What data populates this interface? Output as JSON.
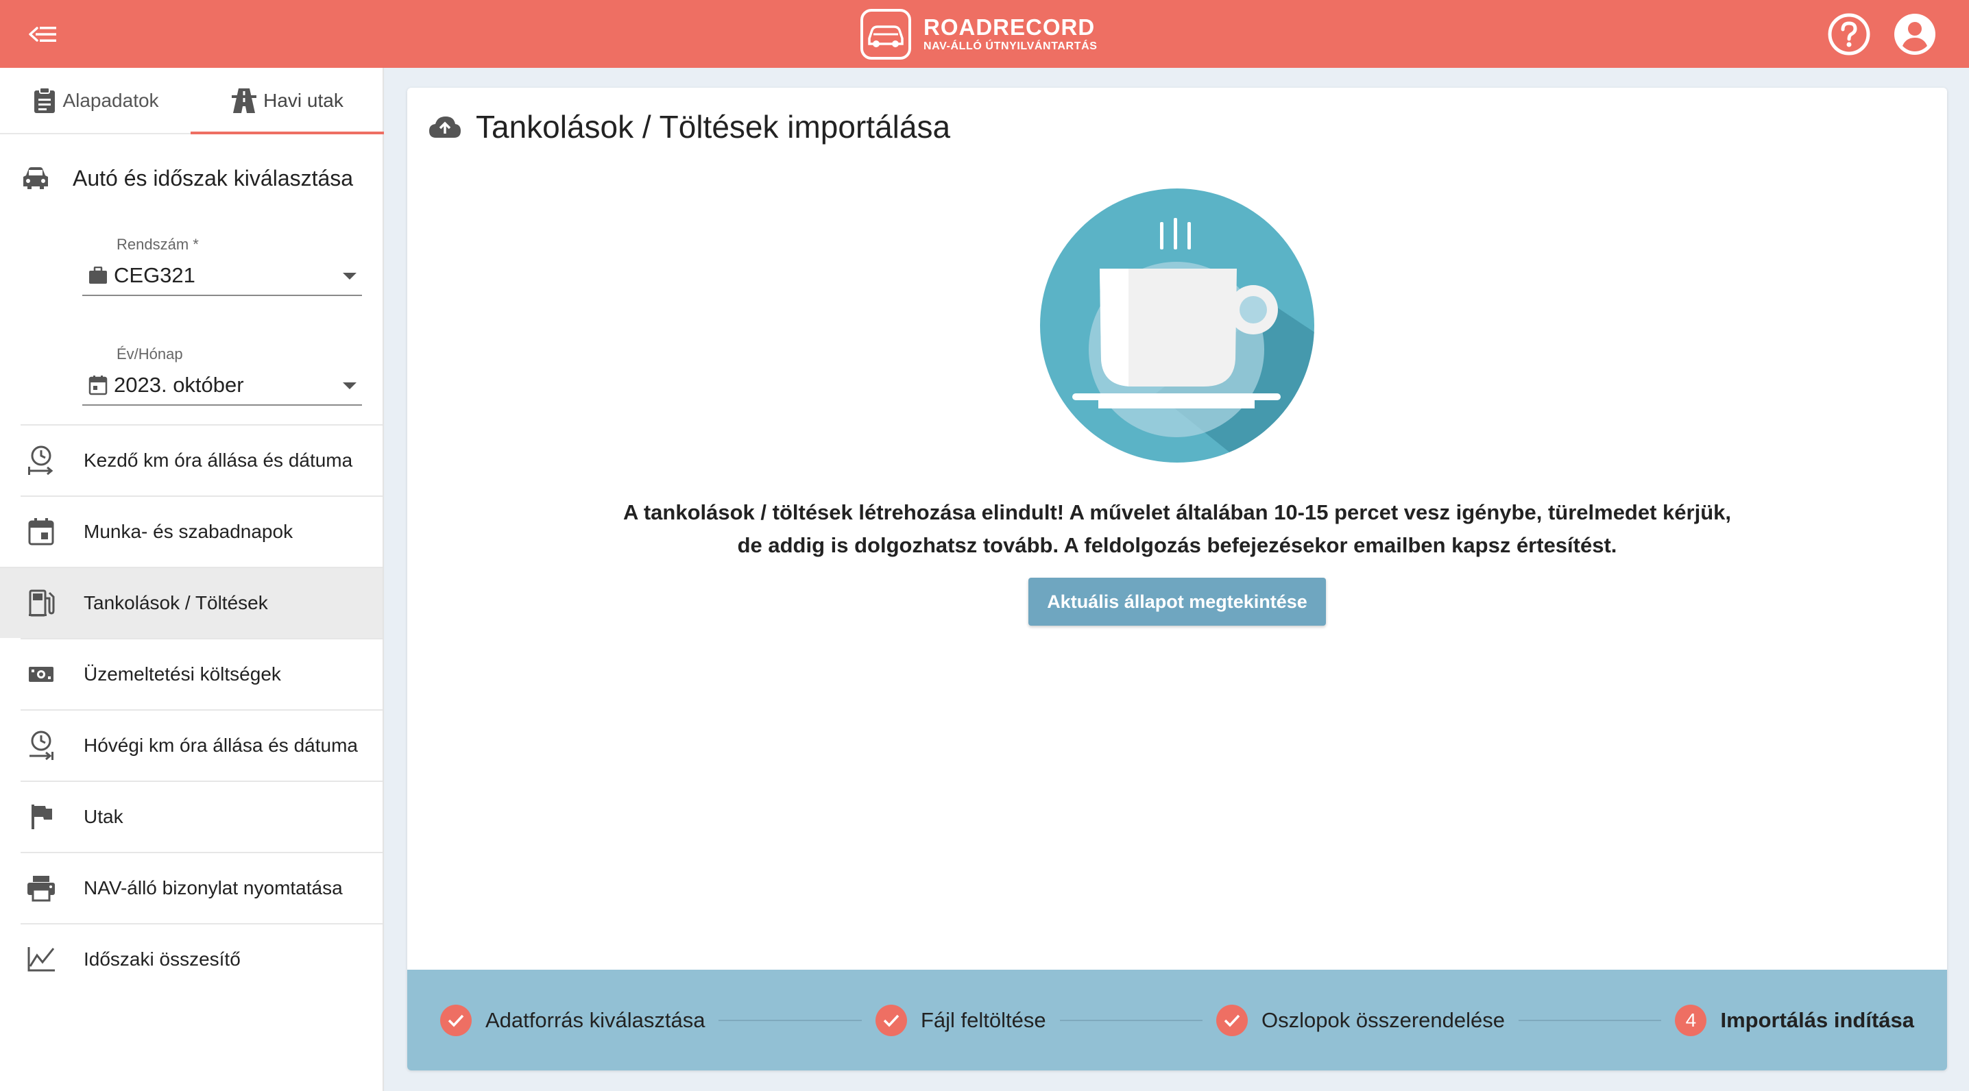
{
  "header": {
    "logo_title": "ROADRECORD",
    "logo_subtitle": "NAV-ÁLLÓ ÚTNYILVÁNTARTÁS",
    "brand_color": "#ee6f63"
  },
  "sidebar": {
    "tabs": [
      {
        "label": "Alapadatok",
        "icon": "clipboard-icon"
      },
      {
        "label": "Havi utak",
        "icon": "road-icon",
        "active": true
      }
    ],
    "section_title": "Autó és időszak kiválasztása",
    "plate_field": {
      "label": "Rendszám *",
      "value": "CEG321"
    },
    "period_field": {
      "label": "Év/Hónap",
      "value": "2023. október"
    },
    "items": [
      {
        "label": "Kezdő km óra állása és dátuma",
        "icon": "clock-start-icon"
      },
      {
        "label": "Munka- és szabadnapok",
        "icon": "calendar-icon"
      },
      {
        "label": "Tankolások / Töltések",
        "icon": "fuel-icon",
        "active": true
      },
      {
        "label": "Üzemeltetési költségek",
        "icon": "money-icon"
      },
      {
        "label": "Hóvégi km óra állása és dátuma",
        "icon": "clock-end-icon"
      },
      {
        "label": "Utak",
        "icon": "flag-icon"
      },
      {
        "label": "NAV-álló bizonylat nyomtatása",
        "icon": "printer-icon"
      },
      {
        "label": "Időszaki összesítő",
        "icon": "chart-icon"
      }
    ]
  },
  "main": {
    "title": "Tankolások / Töltések importálása",
    "message_line1": "A tankolások / töltések létrehozása elindult! A művelet általában 10-15 percet vesz igénybe, türelmedet kérjük,",
    "message_line2": "de addig is dolgozhatsz tovább. A feldolgozás befejezésekor emailben kapsz értesítést.",
    "status_button": "Aktuális állapot megtekintése"
  },
  "stepper": {
    "steps": [
      {
        "label": "Adatforrás kiválasztása",
        "state": "done"
      },
      {
        "label": "Fájl feltöltése",
        "state": "done"
      },
      {
        "label": "Oszlopok összerendelése",
        "state": "done"
      },
      {
        "label": "Importálás indítása",
        "state": "current",
        "number": "4"
      }
    ]
  }
}
